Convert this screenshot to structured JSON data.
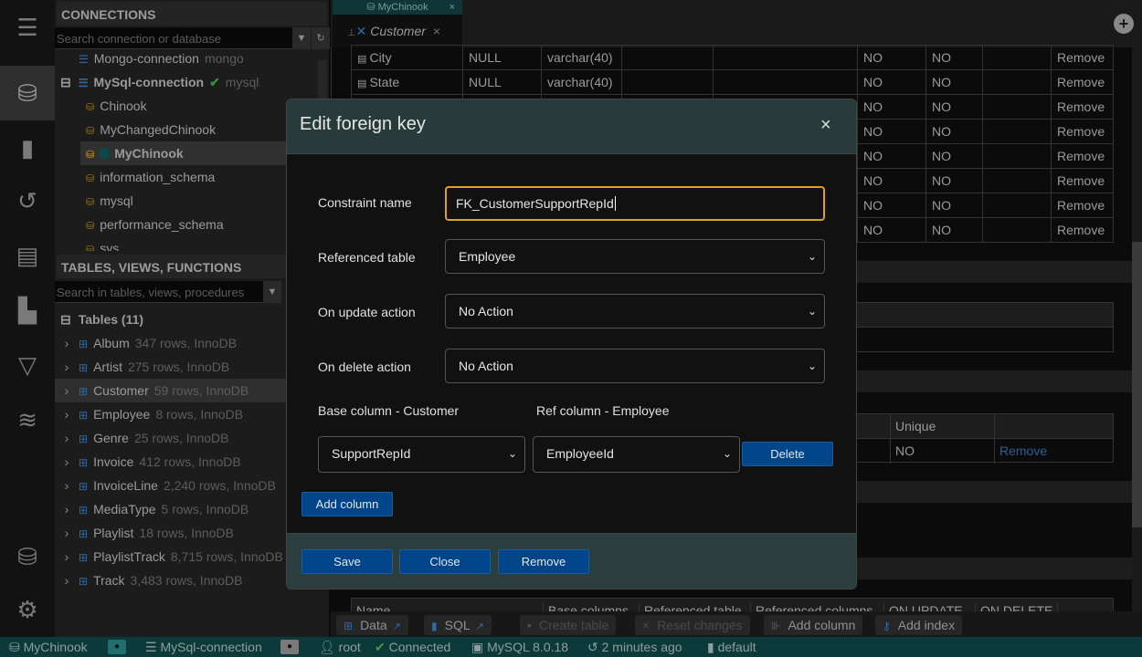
{
  "connections": {
    "header": "CONNECTIONS",
    "search_placeholder": "Search connection or database",
    "items": [
      {
        "label": "Mongo-connection",
        "sub": "mongo"
      },
      {
        "label": "MySql-connection",
        "sub": "mysql",
        "status": "connected"
      },
      {
        "label": "Chinook"
      },
      {
        "label": "MyChangedChinook"
      },
      {
        "label": "MyChinook"
      },
      {
        "label": "information_schema"
      },
      {
        "label": "mysql"
      },
      {
        "label": "performance_schema"
      },
      {
        "label": "sys"
      }
    ]
  },
  "tables_panel": {
    "header": "TABLES, VIEWS, FUNCTIONS",
    "search_placeholder": "Search in tables, views, procedures",
    "group": "Tables (11)",
    "items": [
      {
        "name": "Album",
        "info": "347 rows, InnoDB"
      },
      {
        "name": "Artist",
        "info": "275 rows, InnoDB"
      },
      {
        "name": "Customer",
        "info": "59 rows, InnoDB"
      },
      {
        "name": "Employee",
        "info": "8 rows, InnoDB"
      },
      {
        "name": "Genre",
        "info": "25 rows, InnoDB"
      },
      {
        "name": "Invoice",
        "info": "412 rows, InnoDB"
      },
      {
        "name": "InvoiceLine",
        "info": "2,240 rows, InnoDB"
      },
      {
        "name": "MediaType",
        "info": "5 rows, InnoDB"
      },
      {
        "name": "Playlist",
        "info": "18 rows, InnoDB"
      },
      {
        "name": "PlaylistTrack",
        "info": "8,715 rows, InnoDB"
      },
      {
        "name": "Track",
        "info": "3,483 rows, InnoDB"
      }
    ]
  },
  "tabs": {
    "db_tab": "MyChinook",
    "table_tab": "Customer"
  },
  "columns_table": {
    "rows": [
      {
        "name": "City",
        "default": "NULL",
        "type": "varchar(40)",
        "c1": "NO",
        "c2": "NO",
        "action": "Remove"
      },
      {
        "name": "State",
        "default": "NULL",
        "type": "varchar(40)",
        "c1": "NO",
        "c2": "NO",
        "action": "Remove"
      },
      {
        "c1": "NO",
        "c2": "NO",
        "action": "Remove"
      },
      {
        "c1": "NO",
        "c2": "NO",
        "action": "Remove"
      },
      {
        "c1": "NO",
        "c2": "NO",
        "action": "Remove"
      },
      {
        "c1": "NO",
        "c2": "NO",
        "action": "Remove"
      },
      {
        "c1": "NO",
        "c2": "NO",
        "action": "Remove"
      },
      {
        "c1": "NO",
        "c2": "NO",
        "action": "Remove"
      }
    ]
  },
  "index_table": {
    "header": "Unique",
    "value": "NO",
    "action": "Remove"
  },
  "fk_table": {
    "headers": [
      "Name",
      "Base columns",
      "Referenced table",
      "Referenced columns",
      "ON UPDATE",
      "ON DELETE"
    ]
  },
  "toolbar": {
    "data": "Data",
    "sql": "SQL",
    "create_table": "Create table",
    "reset": "Reset changes",
    "add_column": "Add column",
    "add_index": "Add index"
  },
  "status": {
    "db": "MyChinook",
    "connection": "MySql-connection",
    "user": "root",
    "state": "Connected",
    "server": "MySQL 8.0.18",
    "time": "2 minutes ago",
    "schema": "default"
  },
  "modal": {
    "title": "Edit foreign key",
    "close": "×",
    "constraint_label": "Constraint name",
    "constraint_value": "FK_CustomerSupportRepId",
    "ref_table_label": "Referenced table",
    "ref_table_value": "Employee",
    "on_update_label": "On update action",
    "on_update_value": "No Action",
    "on_delete_label": "On delete action",
    "on_delete_value": "No Action",
    "base_col_label": "Base column - Customer",
    "ref_col_label": "Ref column - Employee",
    "base_col_value": "SupportRepId",
    "ref_col_value": "EmployeeId",
    "delete": "Delete",
    "add_column": "Add column",
    "save": "Save",
    "close_btn": "Close",
    "remove": "Remove"
  },
  "colors": {
    "accent": "#00458a",
    "status_bar": "#0c3a3a",
    "focus": "#e0a020"
  }
}
